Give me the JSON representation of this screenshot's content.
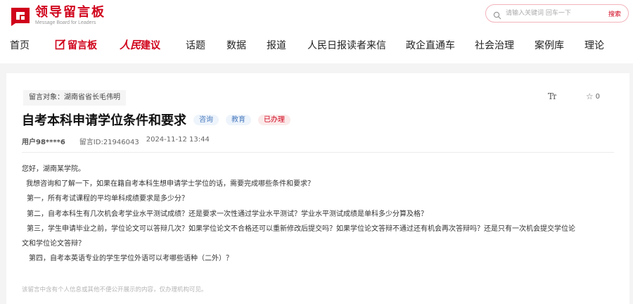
{
  "header": {
    "logo_title": "领导留言板",
    "logo_sub": "Message Board for Leaders",
    "brand_color": "#d0021b"
  },
  "search": {
    "placeholder": "请输入关键词 回车一下",
    "button_label": "搜索",
    "icon": "search-icon"
  },
  "nav": {
    "items": [
      {
        "label": "首页"
      },
      {
        "label": "留言板",
        "icon": "edit-icon",
        "active": true
      },
      {
        "label": "人民",
        "label2": "建议"
      },
      {
        "label": "话题"
      },
      {
        "label": "数据"
      },
      {
        "label": "报道"
      },
      {
        "label": "人民日报读者来信"
      },
      {
        "label": "政企直通车"
      },
      {
        "label": "社会治理"
      },
      {
        "label": "案例库"
      },
      {
        "label": "理论"
      }
    ]
  },
  "message": {
    "target": "留言对象：湖南省省长毛伟明",
    "font_tool_label": "Tт",
    "favorite_count": "0",
    "title": "自考本科申请学位条件和要求",
    "badges": [
      "咨询",
      "教育",
      "已办理"
    ],
    "user": "用户98****6",
    "message_id": "留言ID:21946043",
    "time": "2024-11-12 13:44",
    "paragraphs": [
      "您好，湖南某学院。",
      "我想咨询和了解一下，如果在籍自考本科生想申请学士学位的话，需要完成哪些条件和要求？",
      "第一，所有考试课程的平均单科成绩要求是多少分？",
      "第二，自考本科生有几次机会考学业水平测试成绩？还是要求一次性通过学业水平测试？学业水平测试成绩是单科多少分算及格？",
      "第三，学生申请毕业之前，学位论文可以答辩几次？如果学位论文不合格还可以重新修改后提交吗？如果学位论文答辩不通过还有机会再次答辩吗？还是只有一次机会提交学位论",
      "文和学位论文答辩？",
      "第四，自考本英语专业的学生学位外语可以考哪些语种（二外）？"
    ],
    "privacy_note": "该留言中含有个人信息或其他不便公开展示的内容，仅办理机构可见。"
  }
}
